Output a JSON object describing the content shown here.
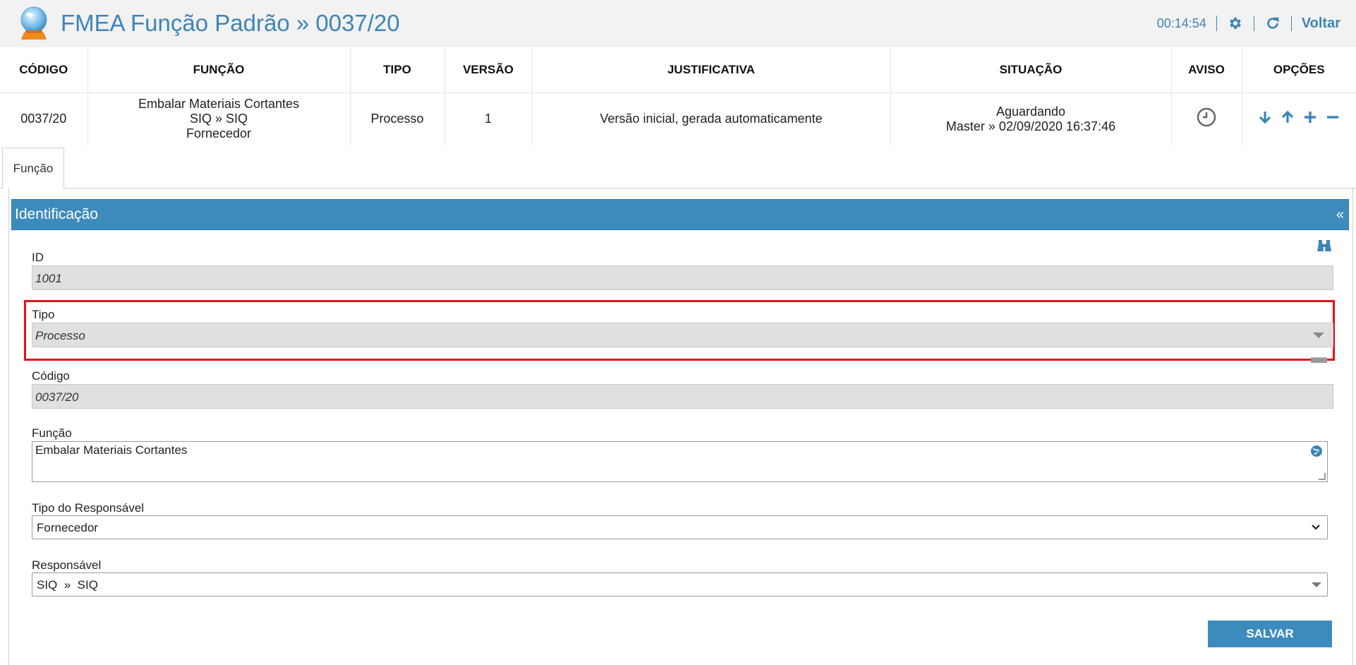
{
  "header": {
    "title": "FMEA Função Padrão » 0037/20",
    "timer": "00:14:54",
    "back_label": "Voltar",
    "settings_icon": "gear-icon",
    "refresh_icon": "refresh-icon"
  },
  "summary": {
    "columns": [
      "CÓDIGO",
      "FUNÇÃO",
      "TIPO",
      "VERSÃO",
      "JUSTIFICATIVA",
      "SITUAÇÃO",
      "AVISO",
      "OPÇÕES"
    ],
    "row": {
      "codigo": "0037/20",
      "funcao_line1": "Embalar Materiais Cortantes",
      "funcao_line2": "SIQ » SIQ",
      "funcao_line3": "Fornecedor",
      "tipo": "Processo",
      "versao": "1",
      "justificativa": "Versão inicial, gerada automaticamente",
      "situacao_line1": "Aguardando",
      "situacao_line2": "Master » 02/09/2020 16:37:46"
    }
  },
  "tabs": [
    {
      "label": "Função",
      "active": true
    }
  ],
  "panel": {
    "title": "Identificação",
    "collapse_glyph": "«"
  },
  "form": {
    "id_label": "ID",
    "id_value": "1001",
    "tipo_label": "Tipo",
    "tipo_value": "Processo",
    "codigo_label": "Código",
    "codigo_value": "0037/20",
    "funcao_label": "Função",
    "funcao_value": "Embalar Materiais Cortantes",
    "tipo_resp_label": "Tipo do Responsável",
    "tipo_resp_value": "Fornecedor",
    "responsavel_label": "Responsável",
    "responsavel_value": "SIQ  »  SIQ",
    "save_label": "SALVAR"
  },
  "colors": {
    "accent": "#3d85b8",
    "panel": "#3d8bbd",
    "highlight": "#e0111b"
  }
}
